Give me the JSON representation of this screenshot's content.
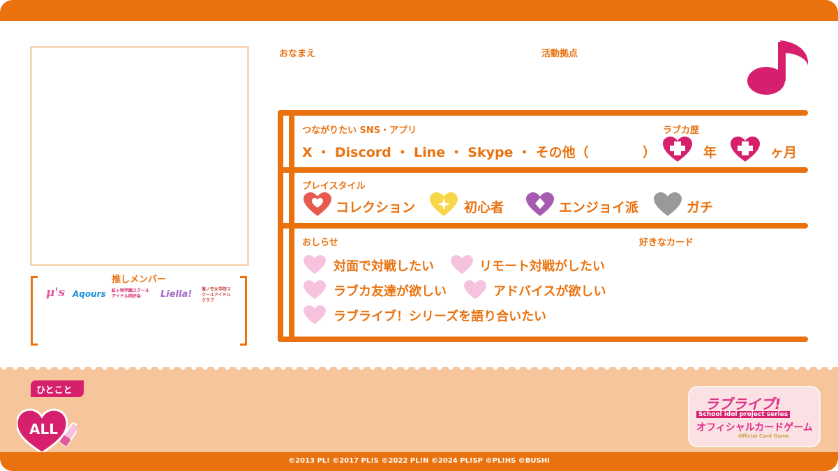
{
  "labels": {
    "name": "おなまえ",
    "base": "活動拠点",
    "sns": "つながりたい SNS・アプリ",
    "career": "ラブカ歴",
    "playstyle": "プレイスタイル",
    "notice": "おしらせ",
    "favorite_card": "好きなカード",
    "oshi": "推しメンバー",
    "hitokoto": "ひとこと"
  },
  "sns_line": {
    "text": "X ・ Discord ・ Line ・ Skype ・ その他（",
    "close": "）",
    "year": "年",
    "month": "ヶ月"
  },
  "playstyles": [
    {
      "label": "コレクション",
      "color": "#e65a4f"
    },
    {
      "label": "初心者",
      "color": "#f7d648"
    },
    {
      "label": "エンジョイ派",
      "color": "#a55cb0"
    },
    {
      "label": "ガチ",
      "color": "#999999"
    }
  ],
  "wishes": [
    "対面で対戦したい",
    "リモート対戦がしたい",
    "ラブカ友達が欲しい",
    "アドバイスが欲しい",
    "ラブライブ！シリーズを語り合いたい"
  ],
  "groups": [
    "μ's",
    "Aqours",
    "虹ヶ咲学園スクールアイドル同好会",
    "Liella!",
    "蓮ノ空女学院スクールアイドルクラブ"
  ],
  "badge": "ALL",
  "brand": {
    "title": "ラブライブ!",
    "subtitle": "School idol project series",
    "name": "オフィシャルカードゲーム",
    "tag": "Official Card Game"
  },
  "copyright": "©2013 PL! ©2017 PL!S ©2022 PL!N ©2024 PL!SP ©PL!HS ©BUSHI",
  "colors": {
    "orange": "#e9720f",
    "peach": "#f7c59b",
    "magenta": "#d6206e",
    "pink_heart": "#f7c2de"
  }
}
